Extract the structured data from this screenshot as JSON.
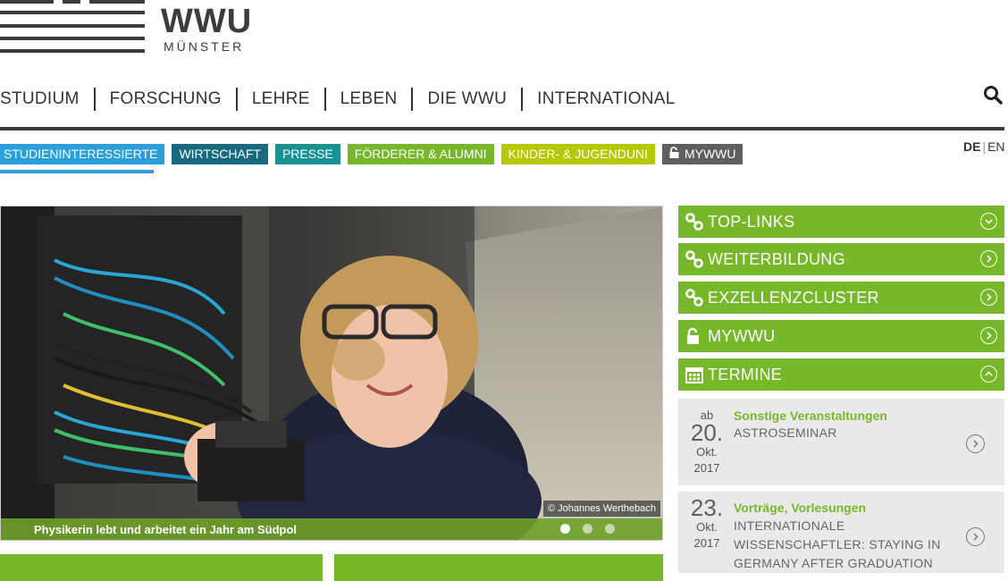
{
  "logo": {
    "name": "WWU",
    "city": "MÜNSTER"
  },
  "mainnav": [
    "STUDIUM",
    "FORSCHUNG",
    "LEHRE",
    "LEBEN",
    "DIE WWU",
    "INTERNATIONAL"
  ],
  "search_icon": "search-icon",
  "targets": [
    {
      "label": "STUDIENINTERESSIERTE",
      "color": "#2b9fd9"
    },
    {
      "label": "WIRTSCHAFT",
      "color": "#176a7f"
    },
    {
      "label": "PRESSE",
      "color": "#1a9293"
    },
    {
      "label": "FÖRDERER & ALUMNI",
      "color": "#77b82a"
    },
    {
      "label": "KINDER- & JUGENDUNI",
      "color": "#b5c800"
    },
    {
      "label": "MYWWU",
      "color": "#5f5f5f",
      "icon": "lock-icon"
    }
  ],
  "lang": {
    "active": "DE",
    "other": "EN"
  },
  "hero": {
    "credit": "© Johannes Werthebach",
    "caption": "Physikerin lebt und arbeitet ein Jahr am Südpol",
    "slides": 3,
    "active_slide": 1
  },
  "accordion": [
    {
      "label": "TOP-LINKS",
      "icon": "link-icon",
      "state": "collapsed"
    },
    {
      "label": "WEITERBILDUNG",
      "icon": "link-icon",
      "state": "collapsed"
    },
    {
      "label": "EXZELLENZCLUSTER",
      "icon": "link-icon",
      "state": "collapsed"
    },
    {
      "label": "MYWWU",
      "icon": "lock-icon",
      "state": "collapsed"
    },
    {
      "label": "TERMINE",
      "icon": "calendar-icon",
      "state": "expanded"
    }
  ],
  "events": [
    {
      "prefix": "ab",
      "day": "20.",
      "month": "Okt.",
      "year": "2017",
      "category": "Sonstige Veranstaltungen",
      "title": "ASTROSEMINAR"
    },
    {
      "prefix": "",
      "day": "23.",
      "month": "Okt.",
      "year": "2017",
      "category": "Vorträge, Vorlesungen",
      "title_lines": [
        "INTERNATIONALE",
        "WISSENSCHAFTLER: STAYING IN",
        "GERMANY AFTER GRADUATION"
      ]
    }
  ],
  "colors": {
    "accent_green": "#77b82a",
    "dark": "#3c3c3c",
    "blue": "#2b9fd9"
  }
}
